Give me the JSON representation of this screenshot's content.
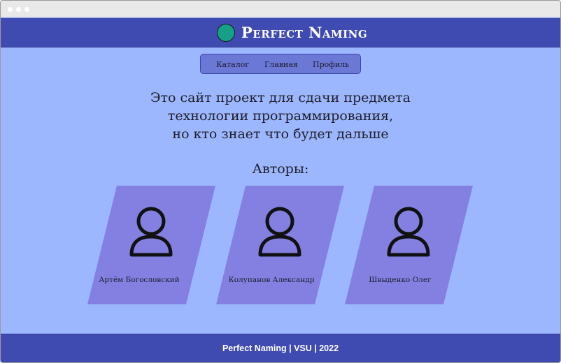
{
  "header": {
    "title": "Perfect Naming",
    "logo_color": "#16a085"
  },
  "nav": {
    "items": [
      {
        "label": "Каталог"
      },
      {
        "label": "Главная"
      },
      {
        "label": "Профиль"
      }
    ]
  },
  "intro": {
    "lines": [
      "Это сайт проект для сдачи предмета",
      "технологии программирования,",
      "но кто знает что будет дальше"
    ]
  },
  "authors": {
    "title": "Авторы:",
    "cards": [
      {
        "name": "Артём Богословский",
        "icon": "user-icon"
      },
      {
        "name": "Колупанов Александр",
        "icon": "user-icon"
      },
      {
        "name": "Швыденко Олег",
        "icon": "user-icon"
      }
    ]
  },
  "footer": {
    "text": "Perfect Naming | VSU | 2022"
  },
  "colors": {
    "page_background": "#9db7ff",
    "header_background": "#3f4bb0",
    "nav_background": "#6b78d6",
    "card_background": "#8380e2"
  }
}
